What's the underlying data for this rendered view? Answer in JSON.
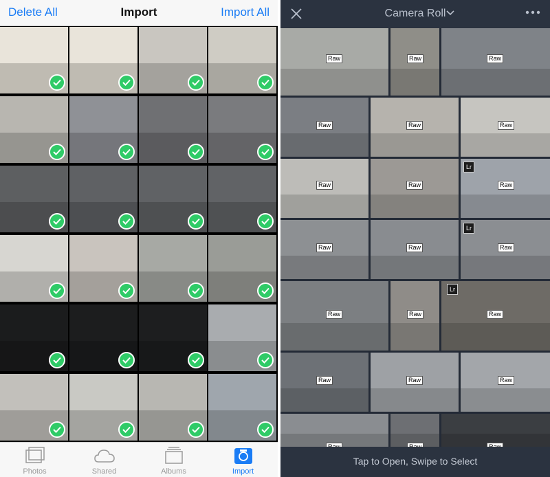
{
  "import_screen": {
    "header": {
      "delete_all": "Delete All",
      "title": "Import",
      "import_all": "Import All"
    },
    "tabs": [
      {
        "label": "Photos",
        "icon": "photos-icon"
      },
      {
        "label": "Shared",
        "icon": "cloud-icon"
      },
      {
        "label": "Albums",
        "icon": "albums-icon"
      },
      {
        "label": "Import",
        "icon": "import-camera-icon",
        "active": true
      }
    ],
    "thumbnail_count": 24,
    "selected_count": 24,
    "colors": {
      "accent": "#1a7cf5",
      "check": "#2fcb67"
    }
  },
  "lightroom_screen": {
    "header": {
      "title": "Camera Roll"
    },
    "badges": {
      "raw": "Raw",
      "lr": "Lr"
    },
    "footer": "Tap to Open, Swipe to Select",
    "colors": {
      "background": "#232a36",
      "bar": "#2b3340"
    }
  }
}
